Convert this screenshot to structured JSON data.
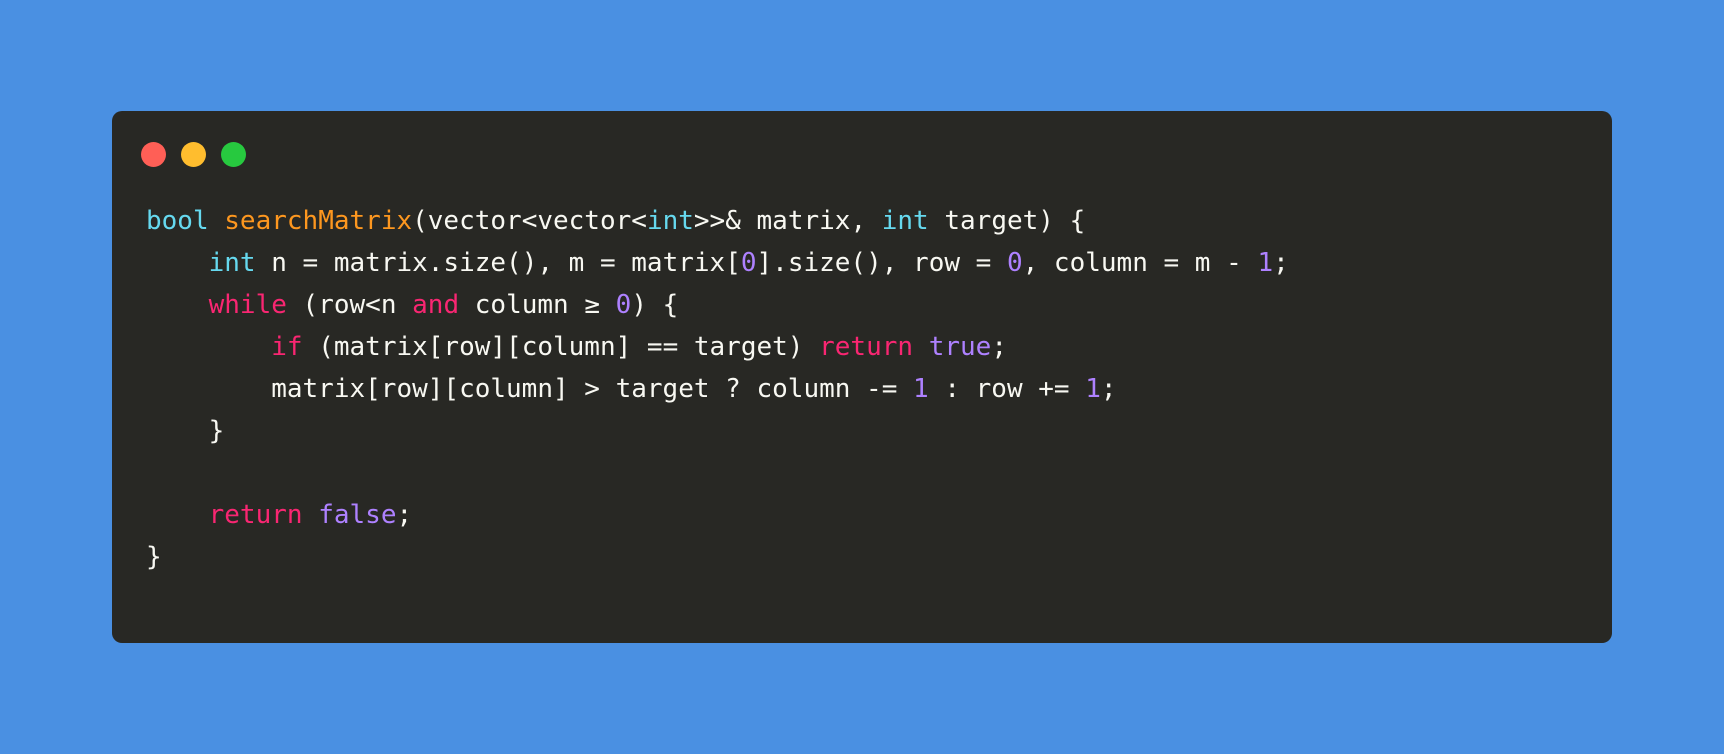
{
  "colors": {
    "background": "#4a90e2",
    "window": "#282824",
    "text": "#f8f8f2",
    "type": "#66d9ef",
    "function": "#fd971f",
    "keyword": "#f92672",
    "number": "#ae81ff",
    "controls": [
      "#ff5f56",
      "#ffbd2e",
      "#27c93f"
    ]
  },
  "window_controls": [
    "close-dot",
    "minimize-dot",
    "maximize-dot"
  ],
  "code_lines": [
    [
      {
        "t": "bool",
        "k": "type"
      },
      {
        "t": " ",
        "k": "plain"
      },
      {
        "t": "searchMatrix",
        "k": "fn"
      },
      {
        "t": "(vector<vector<",
        "k": "plain"
      },
      {
        "t": "int",
        "k": "type"
      },
      {
        "t": ">>& matrix, ",
        "k": "plain"
      },
      {
        "t": "int",
        "k": "type"
      },
      {
        "t": " target) {",
        "k": "plain"
      }
    ],
    [
      {
        "t": "    ",
        "k": "plain"
      },
      {
        "t": "int",
        "k": "type"
      },
      {
        "t": " n = matrix.size(), m = matrix[",
        "k": "plain"
      },
      {
        "t": "0",
        "k": "num"
      },
      {
        "t": "].size(), row = ",
        "k": "plain"
      },
      {
        "t": "0",
        "k": "num"
      },
      {
        "t": ", column = m - ",
        "k": "plain"
      },
      {
        "t": "1",
        "k": "num"
      },
      {
        "t": ";",
        "k": "plain"
      }
    ],
    [
      {
        "t": "    ",
        "k": "plain"
      },
      {
        "t": "while",
        "k": "kw"
      },
      {
        "t": " (row<n ",
        "k": "plain"
      },
      {
        "t": "and",
        "k": "kw"
      },
      {
        "t": " column ≥ ",
        "k": "plain"
      },
      {
        "t": "0",
        "k": "num"
      },
      {
        "t": ") {",
        "k": "plain"
      }
    ],
    [
      {
        "t": "        ",
        "k": "plain"
      },
      {
        "t": "if",
        "k": "kw"
      },
      {
        "t": " (matrix[row][column] == target) ",
        "k": "plain"
      },
      {
        "t": "return",
        "k": "kw"
      },
      {
        "t": " ",
        "k": "plain"
      },
      {
        "t": "true",
        "k": "bool"
      },
      {
        "t": ";",
        "k": "plain"
      }
    ],
    [
      {
        "t": "        matrix[row][column] > target ? column -= ",
        "k": "plain"
      },
      {
        "t": "1",
        "k": "num"
      },
      {
        "t": " : row += ",
        "k": "plain"
      },
      {
        "t": "1",
        "k": "num"
      },
      {
        "t": ";",
        "k": "plain"
      }
    ],
    [
      {
        "t": "    }",
        "k": "plain"
      }
    ],
    [
      {
        "t": "",
        "k": "plain"
      }
    ],
    [
      {
        "t": "    ",
        "k": "plain"
      },
      {
        "t": "return",
        "k": "kw"
      },
      {
        "t": " ",
        "k": "plain"
      },
      {
        "t": "false",
        "k": "bool"
      },
      {
        "t": ";",
        "k": "plain"
      }
    ],
    [
      {
        "t": "}",
        "k": "plain"
      }
    ]
  ]
}
